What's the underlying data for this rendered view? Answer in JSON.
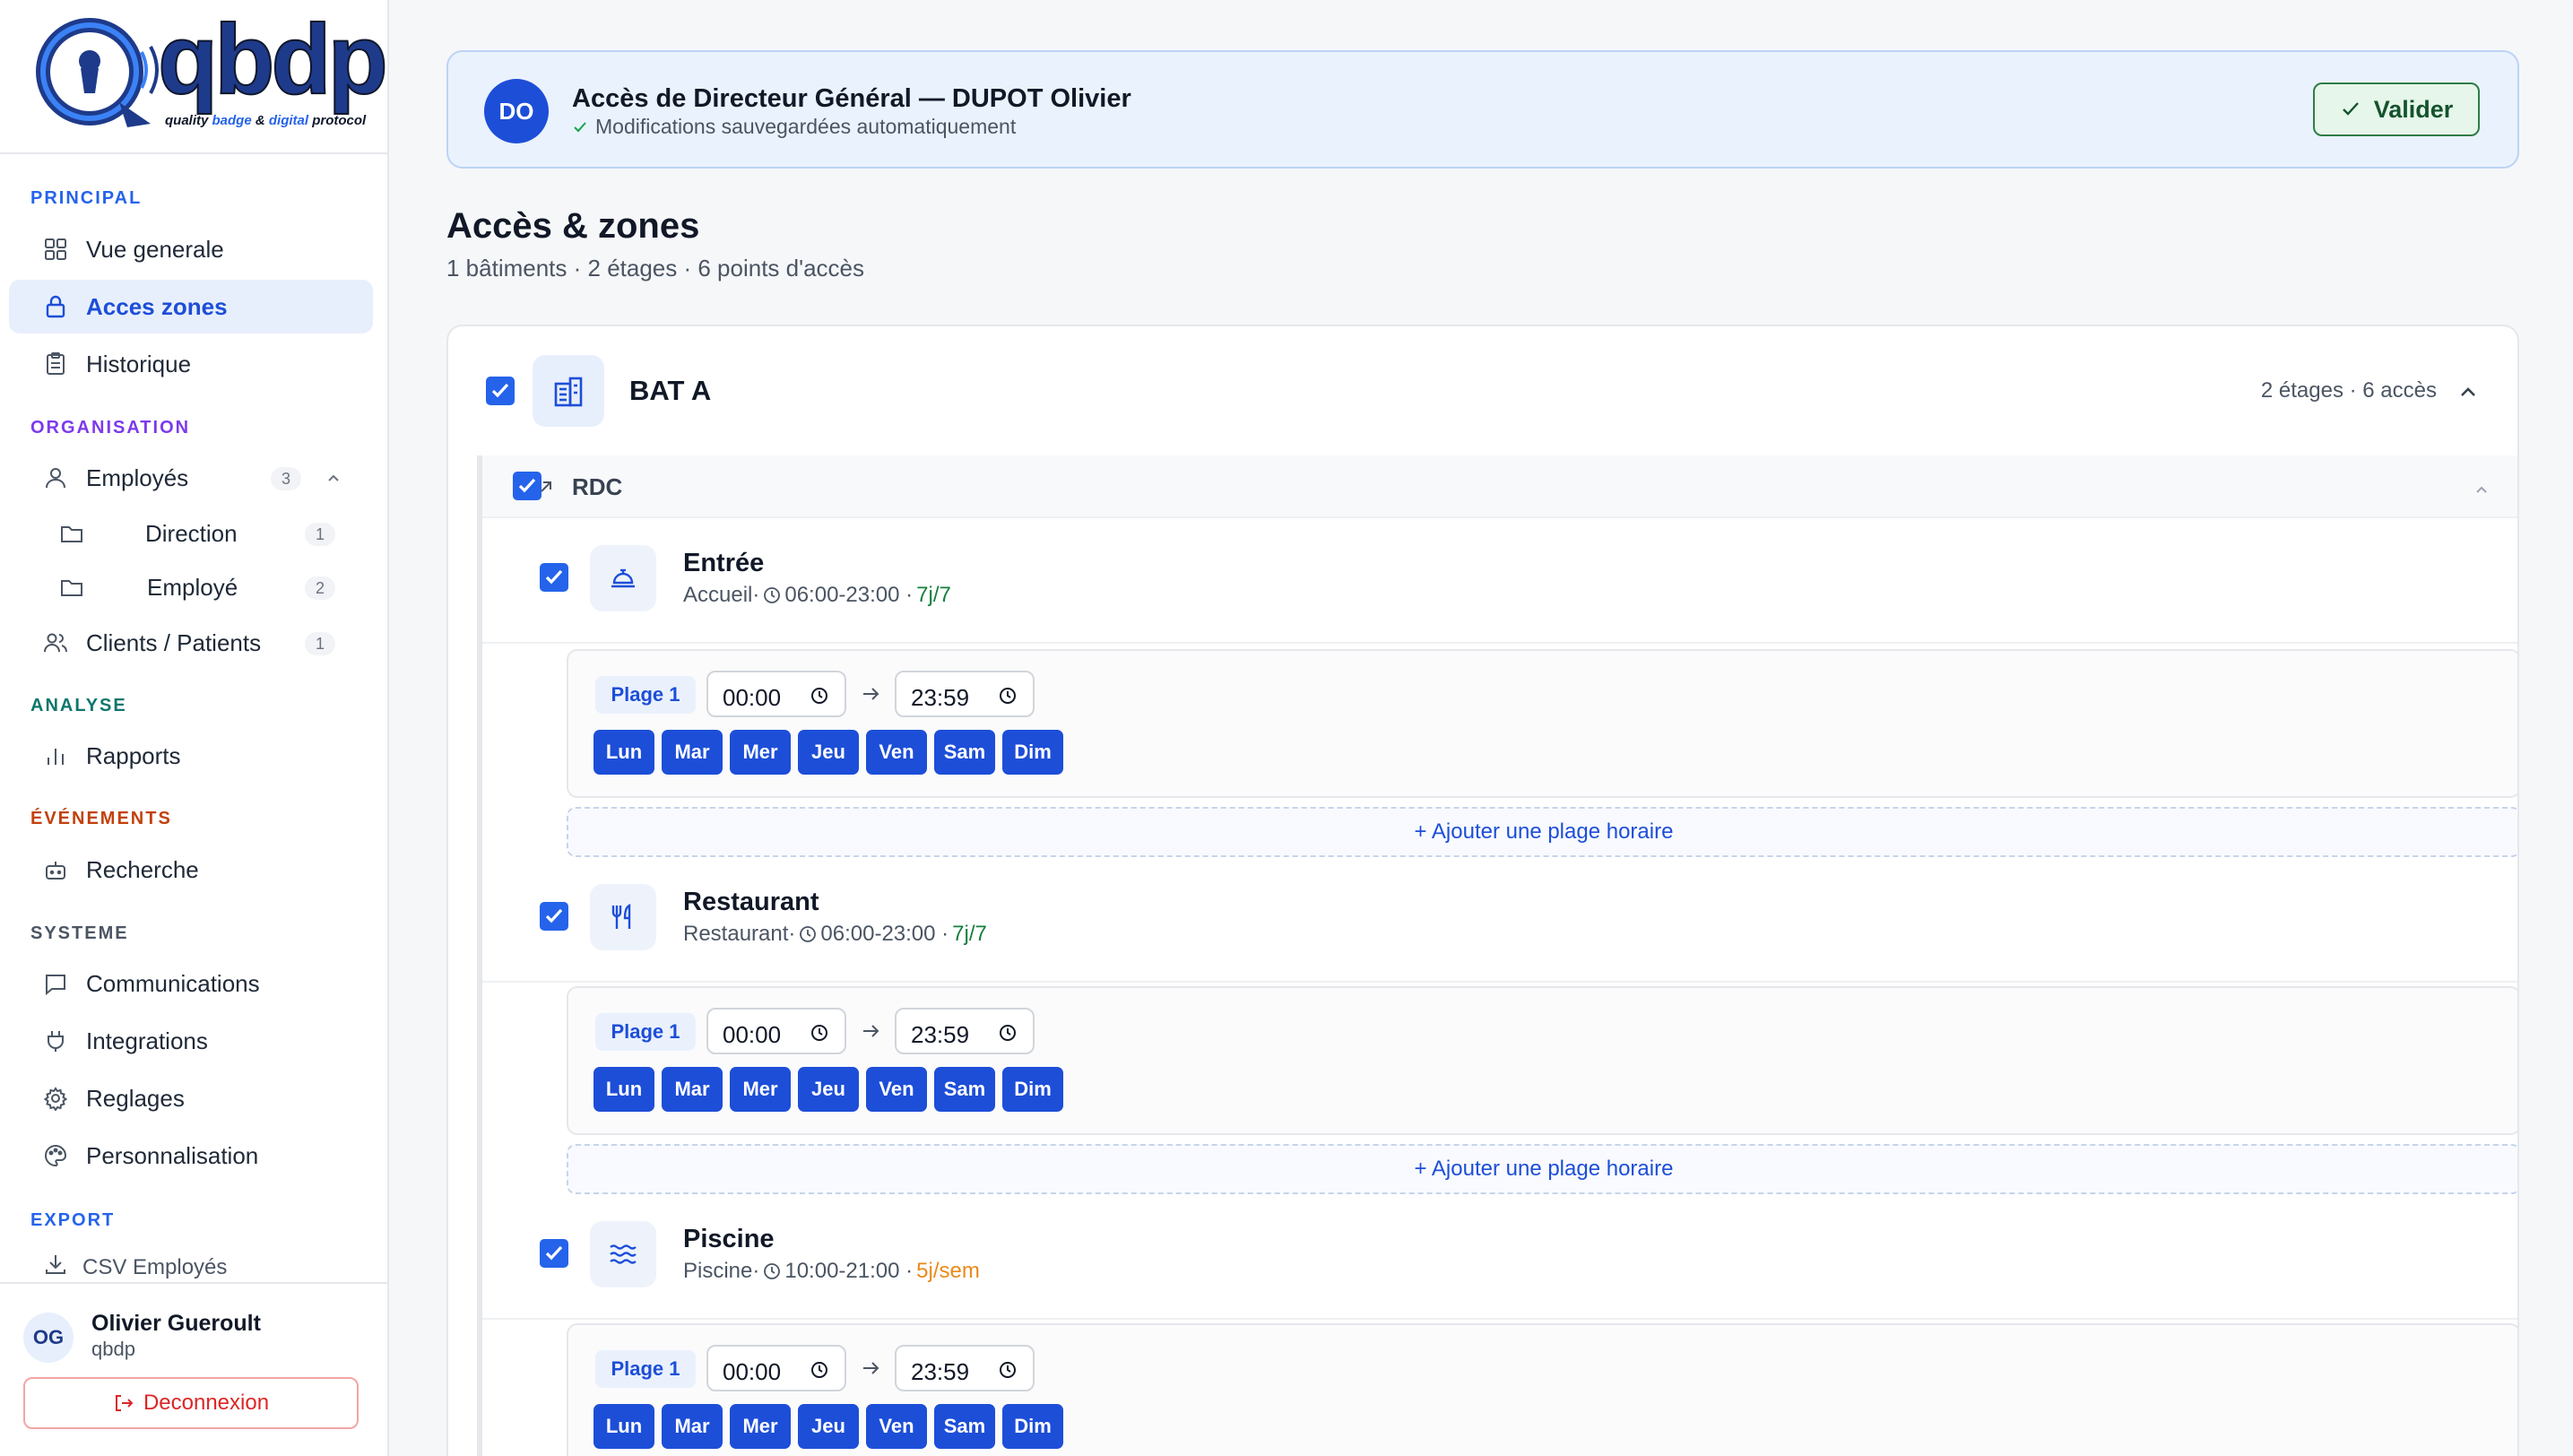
{
  "brand": {
    "logo_text": "qbdp",
    "tagline_1": "quality ",
    "tagline_2": "badge",
    "tagline_3": " & ",
    "tagline_4": "digital",
    "tagline_5": " protocol"
  },
  "sidebar": {
    "sections": {
      "principal": "PRINCIPAL",
      "organisation": "ORGANISATION",
      "analyse": "ANALYSE",
      "evenements": "ÉVÉNEMENTS",
      "systeme": "SYSTEME",
      "export": "EXPORT"
    },
    "section_colors": {
      "principal": "#2563eb",
      "organisation": "#7c3aed",
      "analyse": "#0f766e",
      "evenements": "#c2410c",
      "systeme": "#4b5563",
      "export": "#2563eb"
    },
    "items": {
      "vue_generale": "Vue generale",
      "acces_zones": "Acces zones",
      "historique": "Historique",
      "employes": "Employés",
      "employes_count": "3",
      "direction": "Direction",
      "direction_count": "1",
      "employe": "Employé",
      "employe_count": "2",
      "clients": "Clients / Patients",
      "clients_count": "1",
      "rapports": "Rapports",
      "recherche": "Recherche",
      "communications": "Communications",
      "integrations": "Integrations",
      "reglages": "Reglages",
      "personnalisation": "Personnalisation",
      "csv_employes": "CSV Employés"
    },
    "user": {
      "initials": "OG",
      "name": "Olivier Gueroult",
      "org": "qbdp",
      "logout": "Deconnexion"
    }
  },
  "banner": {
    "initials": "DO",
    "title": "Accès de Directeur Général — DUPOT Olivier",
    "subtitle": "Modifications sauvegardées automatiquement",
    "validate": "Valider"
  },
  "page": {
    "title": "Accès & zones",
    "subtitle": "1 bâtiments · 2 étages · 6 points d'accès"
  },
  "building": {
    "name": "BAT A",
    "meta": "2 étages · 6 accès",
    "floor": {
      "name": "RDC",
      "zones": [
        {
          "name": "Entrée",
          "type": "Accueil·",
          "hours": "06:00-23:00 ·",
          "days_label": "7j/7",
          "plage": "Plage 1",
          "start": "00:00",
          "end": "23:59",
          "add_slot": "+ Ajouter une plage horaire"
        },
        {
          "name": "Restaurant",
          "type": "Restaurant·",
          "hours": "06:00-23:00 ·",
          "days_label": "7j/7",
          "plage": "Plage 1",
          "start": "00:00",
          "end": "23:59",
          "add_slot": "+ Ajouter une plage horaire"
        },
        {
          "name": "Piscine",
          "type": "Piscine·",
          "hours": "10:00-21:00 ·",
          "days_label": "5j/sem",
          "plage": "Plage 1",
          "start": "00:00",
          "end": "23:59"
        }
      ]
    },
    "days": [
      "Lun",
      "Mar",
      "Mer",
      "Jeu",
      "Ven",
      "Sam",
      "Dim"
    ]
  }
}
